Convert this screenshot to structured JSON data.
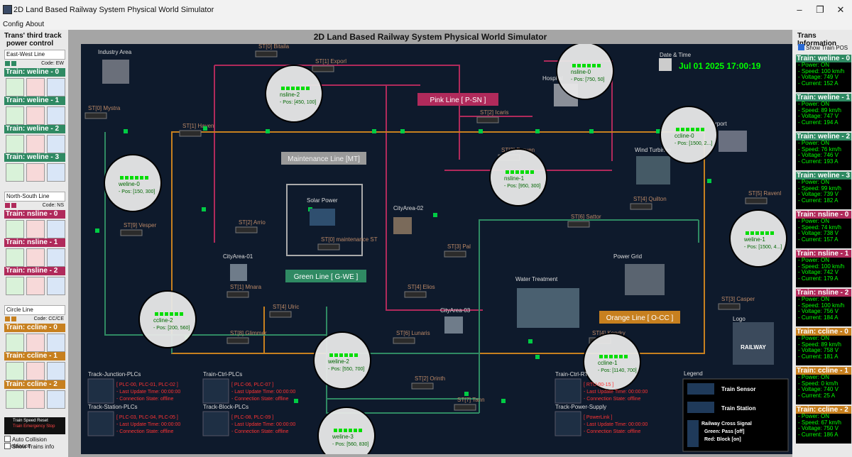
{
  "window": {
    "title": "2D Land Based Railway System Physical World Simulator"
  },
  "menu": [
    "Config",
    "About"
  ],
  "left_panel": {
    "title_1": "Trans' third track",
    "title_2": "power control",
    "sections": [
      {
        "line": "East-West Line",
        "code": "Code: EW",
        "color": "#2f8a63",
        "trains": [
          "Train: weline - 0",
          "Train: weline - 1",
          "Train: weline - 2",
          "Train: weline - 3"
        ]
      },
      {
        "line": "North-South Line",
        "code": "Code: NS",
        "color": "#b02a5b",
        "trains": [
          "Train: nsline - 0",
          "Train: nsline - 1",
          "Train: nsline - 2"
        ]
      },
      {
        "line": "Circle Line",
        "code": "Code: CC/CE",
        "color": "#c7801f",
        "trains": [
          "Train: ccline - 0",
          "Train: ccline - 1",
          "Train: ccline - 2"
        ]
      }
    ],
    "speed_reset": "Train Speed Reset",
    "emergency_stop": "Train Emergency Stop",
    "auto_collision": "Auto Collision Avoidance",
    "show_trains_info": "Show Trains info"
  },
  "map": {
    "title": "2D Land Based Railway System Physical World Simulator",
    "date_label": "Date & Time",
    "datetime": "Jul 01 2025 17:00:19",
    "areas": [
      "Industry Area",
      "Hospital",
      "Airport",
      "Wind Turbines",
      "Solar Power",
      "CityArea-01",
      "CityArea-02",
      "CityArea-03",
      "Power Grid",
      "Water Treatment",
      "Logo"
    ],
    "line_labels": {
      "pink": "Pink Line [ P-SN ]",
      "maint": "Maintenance Line [MT]",
      "green": "Green Line [ G-WE ]",
      "orange": "Orange Line [ O-CC ]"
    },
    "stations": [
      "ST[0] Mystra",
      "ST[1] Haven",
      "ST[0] Bitaila",
      "ST[1] Exporl",
      "ST[2] Icaris",
      "ST[3] Draven",
      "ST[4] Quilton",
      "ST[5] Ravenl",
      "ST[6] Sattor",
      "ST[3] Pal",
      "ST[4] Ulric",
      "ST[9] Vesper",
      "ST[0] maintenance ST",
      "ST[1] Mnara",
      "ST[8] Glimmer",
      "ST[6] Lunaris",
      "ST[2] Orinth",
      "ST[7] Tann",
      "ST[4] Kendry",
      "ST[3] Casper",
      "ST[2] Arrio",
      "ST[4] Elios"
    ],
    "trains": [
      {
        "name": "nsline-2",
        "pos": "- Pos: [450, 100]"
      },
      {
        "name": "nsline-0",
        "pos": "- Pos: [750, 50]"
      },
      {
        "name": "ccline-0",
        "pos": "- Pos: [1500, 2...]"
      },
      {
        "name": "nsline-1",
        "pos": "- Pos: [950, 300]"
      },
      {
        "name": "weline-0",
        "pos": "- Pos: [150, 300]"
      },
      {
        "name": "weline-1",
        "pos": "- Pos: [1500, 4...]"
      },
      {
        "name": "ccline-2",
        "pos": "- Pos: [200, 560]"
      },
      {
        "name": "weline-2",
        "pos": "- Pos: [550, 700]"
      },
      {
        "name": "ccline-1",
        "pos": "- Pos: [1140, 700]"
      },
      {
        "name": "weline-3",
        "pos": "- Pos: [560, 830]"
      }
    ],
    "plc_groups": [
      {
        "title": "Track-Junction-PLCs",
        "l1": "[ PLC-00, PLC-01, PLC-02 ]",
        "l2": "- Last Update Time: 00:00:00",
        "l3": "- Connection State: offline"
      },
      {
        "title": "Train-Ctrl-PLCs",
        "l1": "[ PLC-06, PLC-07 ]",
        "l2": "- Last Update Time: 00:00:00",
        "l3": "- Connection State: offline"
      },
      {
        "title": "Track-Station-PLCs",
        "l1": "[ PLC-03, PLC-04, PLC-05 ]",
        "l2": "- Last Update Time: 00:00:00",
        "l3": "- Connection State: offline"
      },
      {
        "title": "Track-Block-PLCs",
        "l1": "[ PLC-08, PLC-09 ]",
        "l2": "- Last Update Time: 00:00:00",
        "l3": "- Connection State: offline"
      },
      {
        "title": "Train-Ctrl-RTUs",
        "l1": "[ RTU-00-15 ]",
        "l2": "- Last Update Time: 00:00:00",
        "l3": "- Connection State: offline"
      },
      {
        "title": "Track-Power-Supply",
        "l1": "[ PowerLink ]",
        "l2": "- Last Update Time: 00:00:00",
        "l3": "- Connection State: offline"
      }
    ],
    "legend": {
      "title": "Legend",
      "sensor": "Train Sensor",
      "station": "Train Station",
      "cross": "Railway Cross Signal",
      "green": "Green: Pass [off]",
      "red": "Red: Block [on]"
    },
    "logo_text": "RAILWAY"
  },
  "right_panel": {
    "title": "Trans Information",
    "show_pos": "Show Train POS",
    "trains": [
      {
        "name": "Train: weline - 0",
        "power": "- Power: ON",
        "speed": "- Speed: 100 km/h",
        "voltage": "- Voltage: 749 V",
        "current": "- Current: 152 A",
        "color": "#2f8a63"
      },
      {
        "name": "Train: weline - 1",
        "power": "- Power: ON",
        "speed": "- Speed: 89 km/h",
        "voltage": "- Voltage: 747 V",
        "current": "- Current: 194 A",
        "color": "#2f8a63"
      },
      {
        "name": "Train: weline - 2",
        "power": "- Power: ON",
        "speed": "- Speed: 76 km/h",
        "voltage": "- Voltage: 746 V",
        "current": "- Current: 193 A",
        "color": "#2f8a63"
      },
      {
        "name": "Train: weline - 3",
        "power": "- Power: ON",
        "speed": "- Speed: 99 km/h",
        "voltage": "- Voltage: 739 V",
        "current": "- Current: 182 A",
        "color": "#2f8a63"
      },
      {
        "name": "Train: nsline - 0",
        "power": "- Power: ON",
        "speed": "- Speed: 74 km/h",
        "voltage": "- Voltage: 738 V",
        "current": "- Current: 157 A",
        "color": "#b02a5b"
      },
      {
        "name": "Train: nsline - 1",
        "power": "- Power: ON",
        "speed": "- Speed: 100 km/h",
        "voltage": "- Voltage: 742 V",
        "current": "- Current: 179 A",
        "color": "#b02a5b"
      },
      {
        "name": "Train: nsline - 2",
        "power": "- Power: ON",
        "speed": "- Speed: 100 km/h",
        "voltage": "- Voltage: 756 V",
        "current": "- Current: 184 A",
        "color": "#b02a5b"
      },
      {
        "name": "Train: ccline - 0",
        "power": "- Power: ON",
        "speed": "- Speed: 89 km/h",
        "voltage": "- Voltage: 758 V",
        "current": "- Current: 181 A",
        "color": "#c7801f"
      },
      {
        "name": "Train: ccline - 1",
        "power": "- Power: ON",
        "speed": "- Speed: 0 km/h",
        "voltage": "- Voltage: 740 V",
        "current": "- Current: 25 A",
        "color": "#c7801f"
      },
      {
        "name": "Train: ccline - 2",
        "power": "- Power: ON",
        "speed": "- Speed: 67 km/h",
        "voltage": "- Voltage: 750 V",
        "current": "- Current: 186 A",
        "color": "#c7801f"
      }
    ]
  },
  "colors": {
    "map_bg": "#0e1a2c",
    "pink": "#b02a5b",
    "green": "#2f8a63",
    "orange": "#c7801f",
    "maint": "#aaaaaa",
    "ok": "#00ff00",
    "alarm": "#ff0000"
  }
}
